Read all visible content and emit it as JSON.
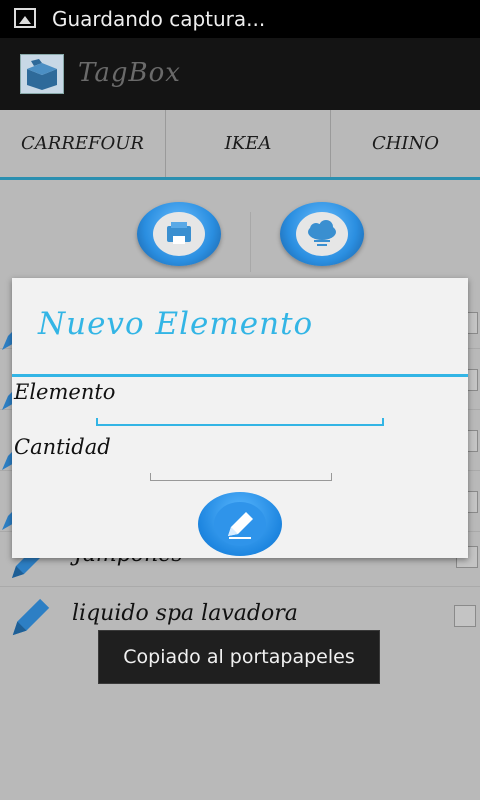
{
  "status_bar": {
    "text": "Guardando captura...",
    "icon": "image-icon"
  },
  "action_bar": {
    "title": "TagBox",
    "logo_icon": "box-logo-icon"
  },
  "tabs": [
    {
      "label": "CARREFOUR"
    },
    {
      "label": "IKEA"
    },
    {
      "label": "CHINO"
    }
  ],
  "top_buttons": {
    "left_icon": "printer-icon",
    "right_icon": "cloud-icon"
  },
  "list": {
    "items": [
      {
        "label": "Jampones"
      },
      {
        "label": "liquido spa lavadora"
      }
    ]
  },
  "dialog": {
    "title": "Nuevo Elemento",
    "element_label": "Elemento",
    "element_value": "",
    "quantity_label": "Cantidad",
    "quantity_value": "",
    "confirm_icon": "pencil-icon"
  },
  "toast": {
    "text": "Copiado al portapapeles"
  },
  "colors": {
    "accent": "#33b5e5",
    "dim_background": "#b9b9b9",
    "button_blue": "#1e86e0"
  }
}
